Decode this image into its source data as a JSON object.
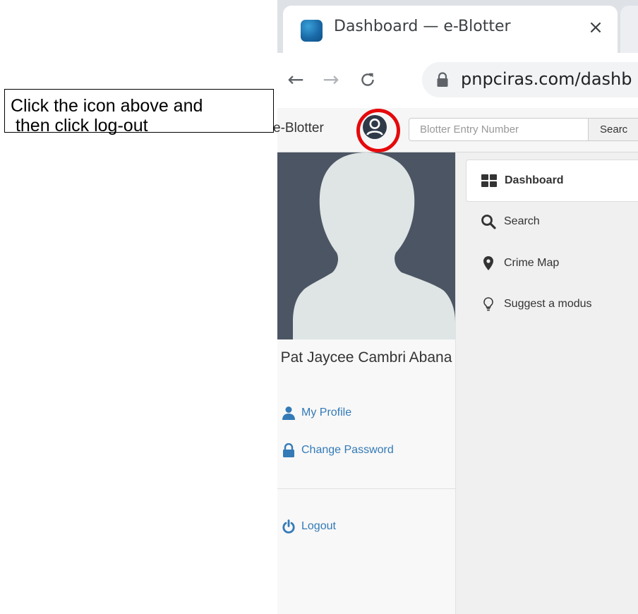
{
  "browser": {
    "tab_title": "Dashboard — e-Blotter",
    "tab_close": "×",
    "url": "pnpciras.com/dashb",
    "nav": {
      "back": "←",
      "forward": "→",
      "reload": "C"
    }
  },
  "header": {
    "brand": "e-Blotter",
    "search_placeholder": "Blotter Entry Number",
    "search_button": "Searc"
  },
  "callout": {
    "text": "Click the icon above and\n then click log-out"
  },
  "sidebar": {
    "user_name": "Pat Jaycee Cambri Abana",
    "links": {
      "my_profile": "My Profile",
      "change_password": "Change Password",
      "logout": "Logout"
    }
  },
  "main_nav": {
    "items": [
      {
        "label": "Dashboard",
        "icon": "grid-icon",
        "active": true
      },
      {
        "label": "Search",
        "icon": "search-icon",
        "active": false
      },
      {
        "label": "Crime Map",
        "icon": "map-marker-icon",
        "active": false
      },
      {
        "label": "Suggest a modus",
        "icon": "lightbulb-icon",
        "active": false
      }
    ]
  },
  "colors": {
    "highlight_ring": "#e5090b",
    "link_blue": "#337ab7",
    "sidebar_photo_bg": "#4c5564"
  }
}
